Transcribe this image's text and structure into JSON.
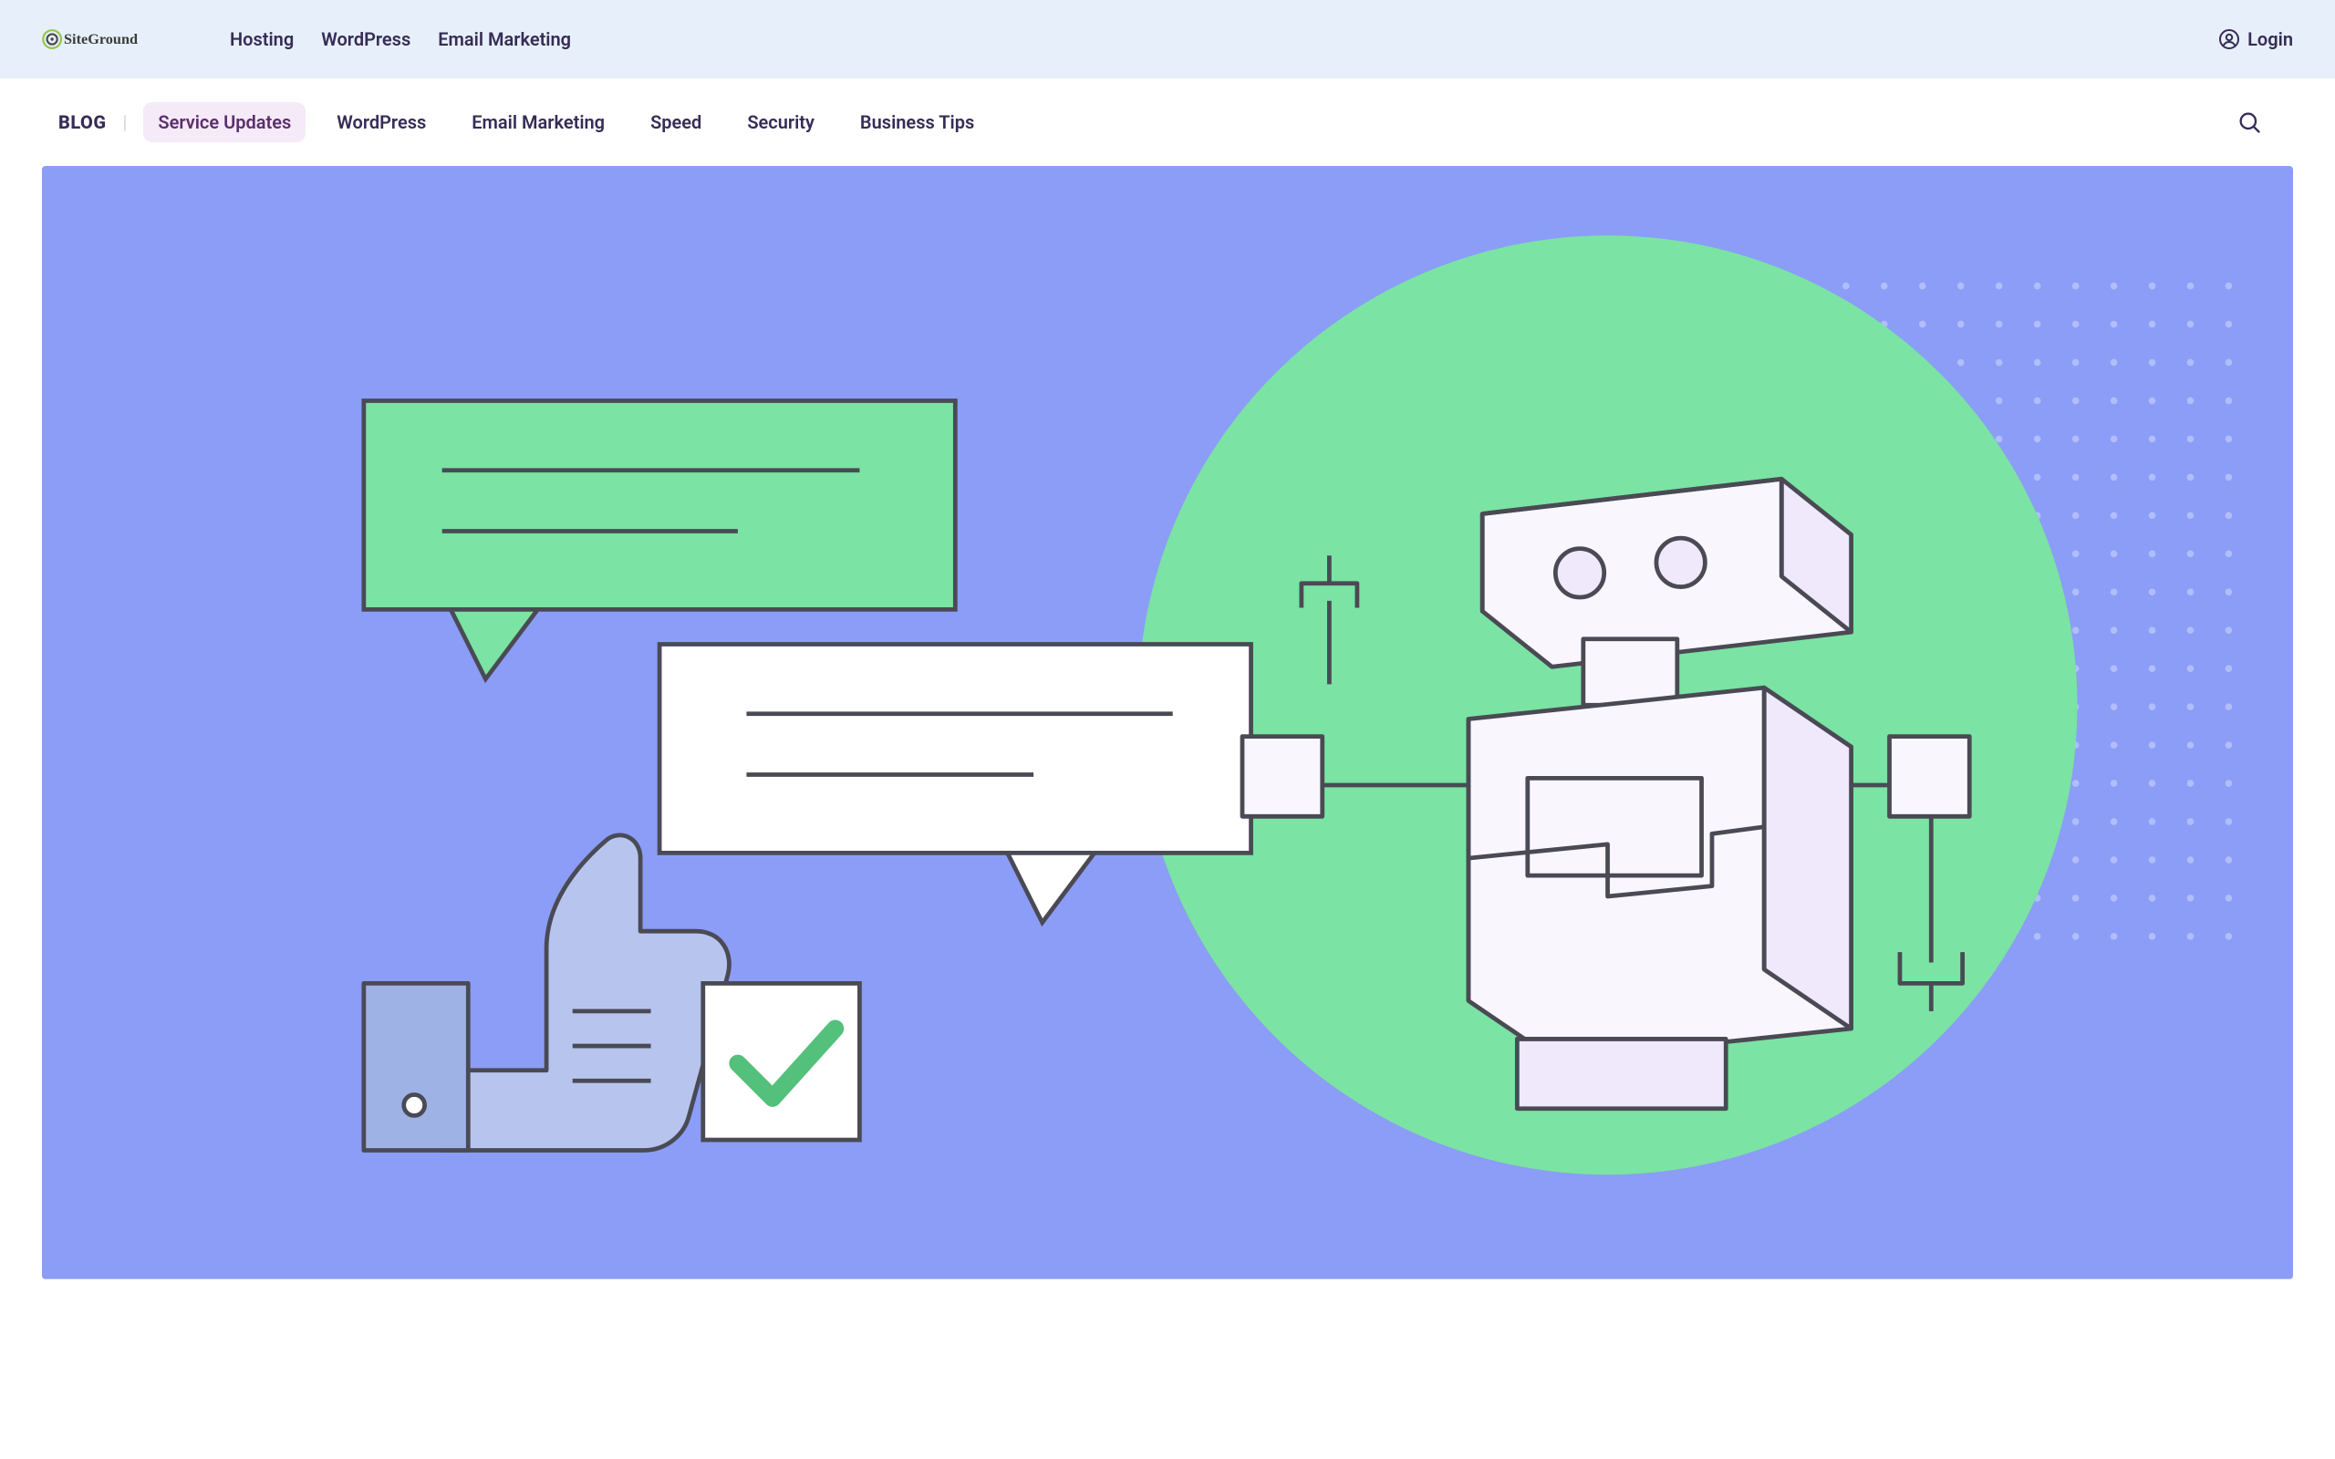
{
  "brand": {
    "name": "SiteGround"
  },
  "topnav": {
    "items": [
      "Hosting",
      "WordPress",
      "Email Marketing"
    ]
  },
  "auth": {
    "login_label": "Login"
  },
  "blognav": {
    "label": "BLOG",
    "tabs": [
      {
        "label": "Service Updates",
        "active": true
      },
      {
        "label": "WordPress",
        "active": false
      },
      {
        "label": "Email Marketing",
        "active": false
      },
      {
        "label": "Speed",
        "active": false
      },
      {
        "label": "Security",
        "active": false
      },
      {
        "label": "Business Tips",
        "active": false
      }
    ]
  },
  "hero": {
    "illustration": "ai-chatbot-robot-conversation",
    "colors": {
      "bg": "#8b9df6",
      "circle": "#7be3a3",
      "bubble1": "#7be3a3",
      "bubble2": "#ffffff",
      "thumb": "#b7c5ee",
      "checkbox_bg": "#ffffff",
      "check": "#53c07b",
      "outline": "#4a4a55",
      "robot_body": "#f9f6fd",
      "robot_shadow": "#efe9fb",
      "dots": "#b1befb"
    }
  }
}
